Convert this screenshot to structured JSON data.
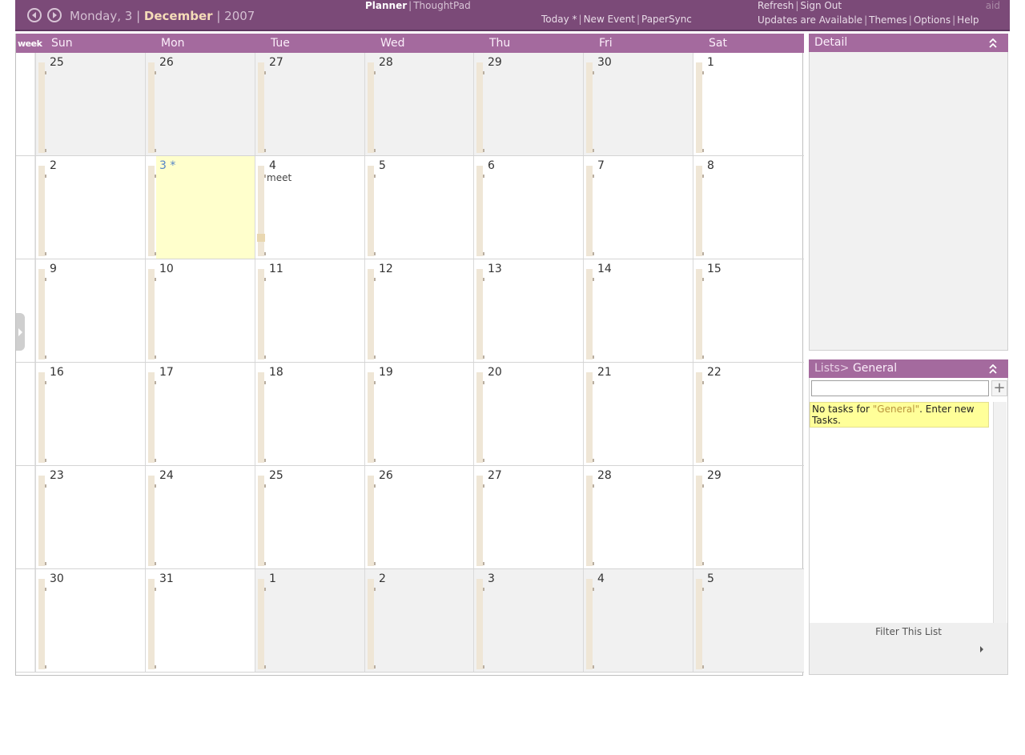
{
  "header": {
    "weekday_day": "Monday, 3",
    "month": "December",
    "year": "2007",
    "modes": [
      "Planner",
      "ThoughtPad"
    ],
    "actions": [
      "Today *",
      "New Event",
      "PaperSync"
    ],
    "right_top": [
      "Refresh",
      "Sign Out"
    ],
    "right_bottom": [
      "Updates are Available",
      "Themes",
      "Options",
      "Help"
    ],
    "user": "aid"
  },
  "calendar": {
    "week_toggle": "week",
    "day_names": [
      "Sun",
      "Mon",
      "Tue",
      "Wed",
      "Thu",
      "Fri",
      "Sat"
    ],
    "weeks": [
      [
        {
          "n": "25",
          "other": true
        },
        {
          "n": "26",
          "other": true
        },
        {
          "n": "27",
          "other": true
        },
        {
          "n": "28",
          "other": true
        },
        {
          "n": "29",
          "other": true
        },
        {
          "n": "30",
          "other": true
        },
        {
          "n": "1"
        }
      ],
      [
        {
          "n": "2"
        },
        {
          "n": "3 *",
          "today": true
        },
        {
          "n": "4",
          "event": "meet"
        },
        {
          "n": "5"
        },
        {
          "n": "6"
        },
        {
          "n": "7"
        },
        {
          "n": "8"
        }
      ],
      [
        {
          "n": "9"
        },
        {
          "n": "10"
        },
        {
          "n": "11"
        },
        {
          "n": "12"
        },
        {
          "n": "13"
        },
        {
          "n": "14"
        },
        {
          "n": "15"
        }
      ],
      [
        {
          "n": "16"
        },
        {
          "n": "17"
        },
        {
          "n": "18"
        },
        {
          "n": "19"
        },
        {
          "n": "20"
        },
        {
          "n": "21"
        },
        {
          "n": "22"
        }
      ],
      [
        {
          "n": "23"
        },
        {
          "n": "24"
        },
        {
          "n": "25"
        },
        {
          "n": "26"
        },
        {
          "n": "27"
        },
        {
          "n": "28"
        },
        {
          "n": "29"
        }
      ],
      [
        {
          "n": "30"
        },
        {
          "n": "31"
        },
        {
          "n": "1",
          "other": true
        },
        {
          "n": "2",
          "other": true
        },
        {
          "n": "3",
          "other": true
        },
        {
          "n": "4",
          "other": true
        },
        {
          "n": "5",
          "other": true
        }
      ]
    ]
  },
  "detail": {
    "title": "Detail"
  },
  "lists": {
    "title_prefix": "Lists>",
    "title_name": "General",
    "input_value": "",
    "empty_before": "No tasks for ",
    "empty_name": "\"General\"",
    "empty_after": ". Enter new Tasks.",
    "filter_label": "Filter This List"
  },
  "colors": {
    "header_bg": "#7b4a78",
    "panel_head": "#a46a9e",
    "today_bg": "#ffffcc",
    "other_month_bg": "#f1f1f1",
    "notice_bg": "#ffff99"
  }
}
